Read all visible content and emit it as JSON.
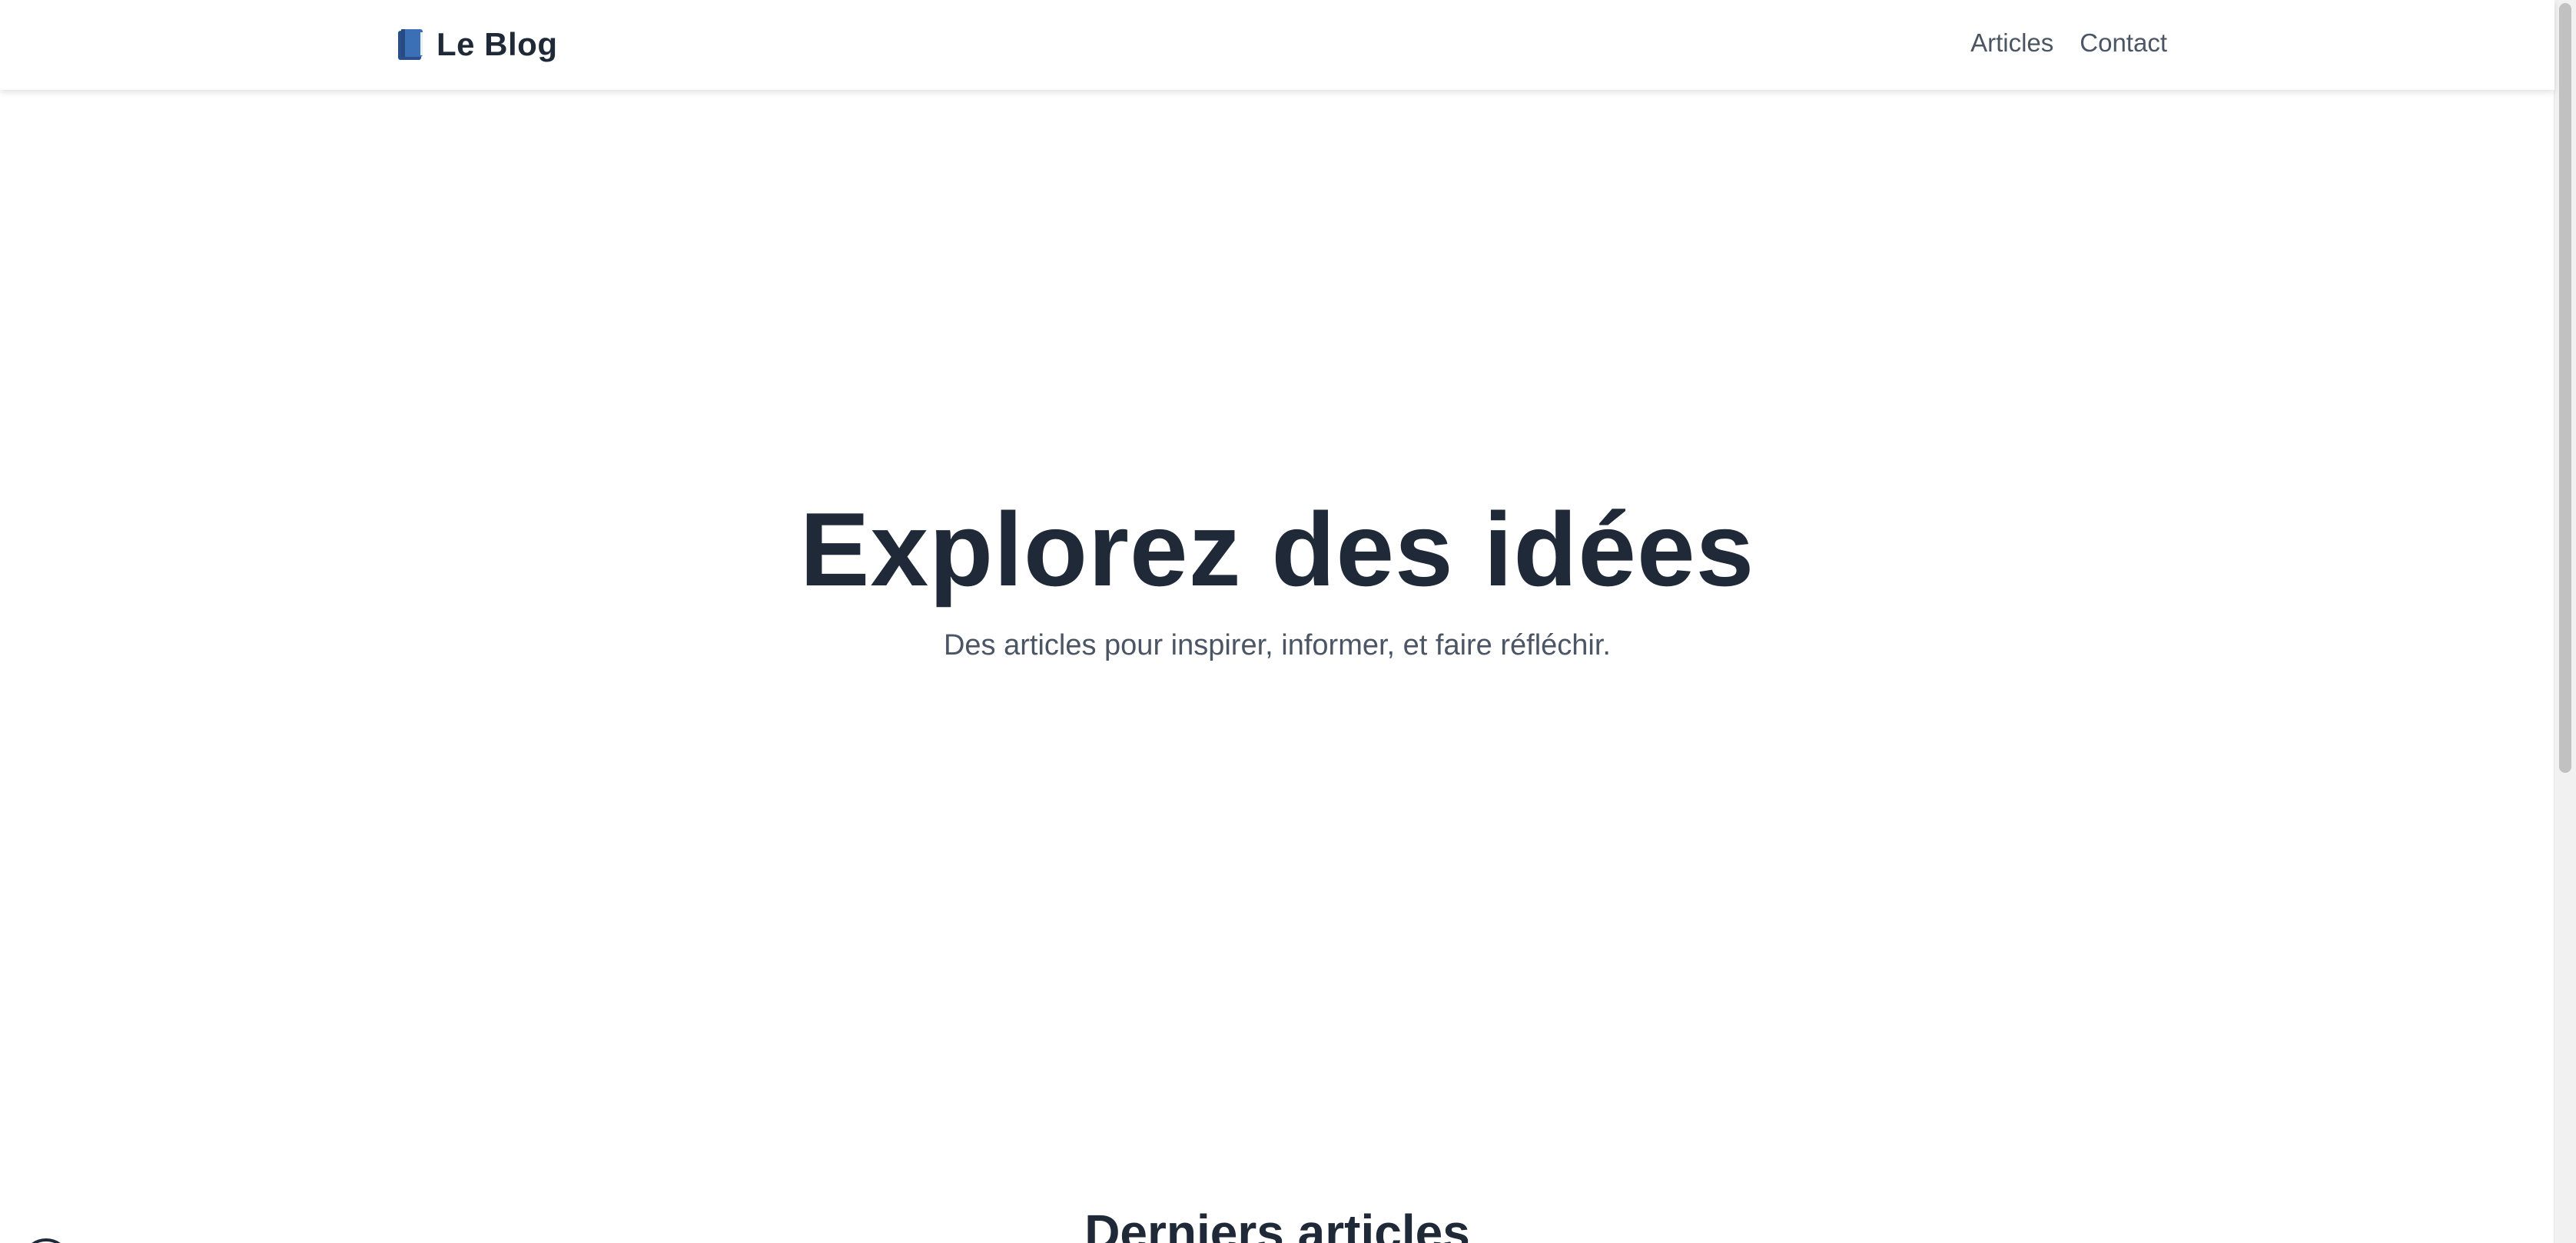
{
  "header": {
    "brand": {
      "icon": "book-icon",
      "label": "Le Blog"
    },
    "nav": [
      {
        "label": "Articles"
      },
      {
        "label": "Contact"
      }
    ]
  },
  "hero": {
    "title": "Explorez des idées",
    "subtitle": "Des articles pour inspirer, informer, et faire réfléchir."
  },
  "latest": {
    "title": "Derniers articles"
  },
  "colors": {
    "text_dark": "#1f2937",
    "text_muted": "#4b5563",
    "book_blue": "#3b6fb6"
  }
}
